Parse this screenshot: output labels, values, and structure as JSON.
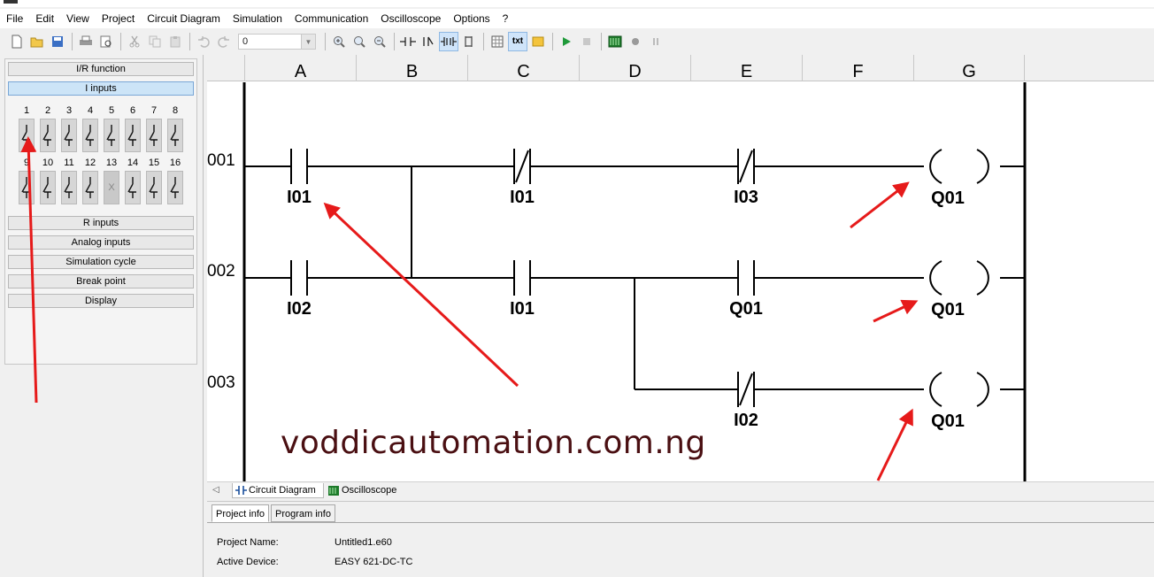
{
  "menu": [
    "File",
    "Edit",
    "View",
    "Project",
    "Circuit Diagram",
    "Simulation",
    "Communication",
    "Oscilloscope",
    "Options",
    "?"
  ],
  "toolbar": {
    "zoom_value": "0",
    "text_toggle_label": "txt"
  },
  "left_panel": {
    "sections_top": [
      "I/R function",
      "I inputs"
    ],
    "sections_bottom": [
      "R inputs",
      "Analog inputs",
      "Simulation cycle",
      "Break point",
      "Display"
    ],
    "input_numbers_row1": [
      "1",
      "2",
      "3",
      "4",
      "5",
      "6",
      "7",
      "8"
    ],
    "input_numbers_row2": [
      "9",
      "10",
      "11",
      "12",
      "13",
      "14",
      "15",
      "16"
    ],
    "disabled_cell_mark": "X"
  },
  "circuit": {
    "columns": [
      "A",
      "B",
      "C",
      "D",
      "E",
      "F",
      "G"
    ],
    "rows": [
      "001",
      "002",
      "003"
    ],
    "contacts": {
      "r1_a": "I01",
      "r1_c": "I01",
      "r1_e": "I03",
      "r1_coil": "Q01",
      "r2_a": "I02",
      "r2_c": "I01",
      "r2_e": "Q01",
      "r2_coil": "Q01",
      "r3_e": "I02",
      "r3_coil": "Q01"
    },
    "watermark": "voddicautomation.com.ng"
  },
  "tabs": {
    "scroll_icon": "◁",
    "circuit": "Circuit Diagram",
    "oscilloscope": "Oscilloscope"
  },
  "info": {
    "tabs": [
      "Project info",
      "Program info"
    ],
    "project_name_label": "Project Name:",
    "project_name_value": "Untitled1.e60",
    "active_device_label": "Active Device:",
    "active_device_value": "EASY 621-DC-TC"
  },
  "colors": {
    "annotation_arrow": "#e61a1a",
    "watermark": "#4a0f12",
    "selected_section": "#cce4f7"
  }
}
